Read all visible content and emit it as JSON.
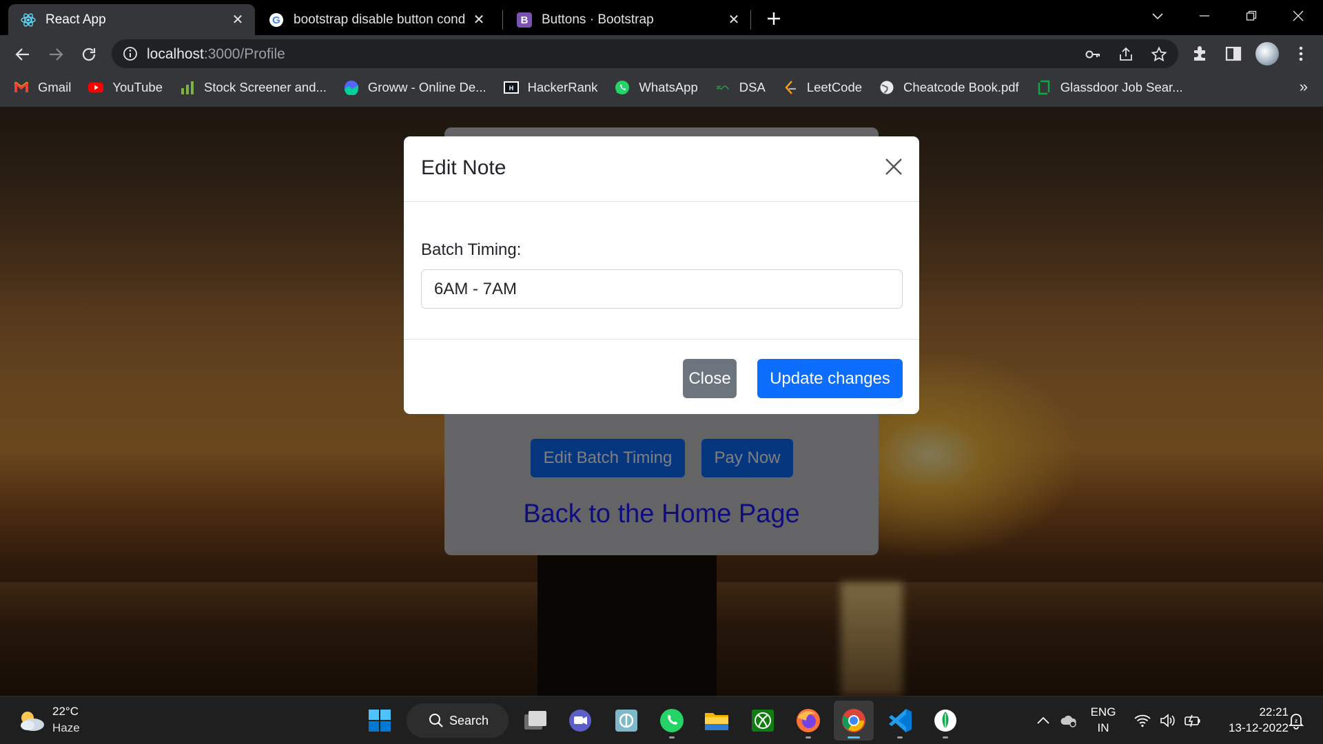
{
  "browser": {
    "tabs": [
      {
        "title": "React App",
        "icon": "react-icon",
        "active": true
      },
      {
        "title": "bootstrap disable button conditio",
        "icon": "google-icon",
        "active": false
      },
      {
        "title": "Buttons · Bootstrap",
        "icon": "bootstrap-icon",
        "active": false
      }
    ],
    "url_host": "localhost",
    "url_path": ":3000/Profile",
    "bookmarks": [
      {
        "label": "Gmail",
        "icon": "gmail-icon"
      },
      {
        "label": "YouTube",
        "icon": "youtube-icon"
      },
      {
        "label": "Stock Screener and...",
        "icon": "stock-chart-icon"
      },
      {
        "label": "Groww - Online De...",
        "icon": "groww-icon"
      },
      {
        "label": "HackerRank",
        "icon": "hackerrank-icon"
      },
      {
        "label": "WhatsApp",
        "icon": "whatsapp-icon"
      },
      {
        "label": "DSA",
        "icon": "dsa-icon"
      },
      {
        "label": "LeetCode",
        "icon": "leetcode-icon"
      },
      {
        "label": "Cheatcode Book.pdf",
        "icon": "globe-icon"
      },
      {
        "label": "Glassdoor Job Sear...",
        "icon": "glassdoor-icon"
      }
    ],
    "bookmarks_more": "»"
  },
  "page": {
    "edit_batch_label": "Edit Batch Timing",
    "pay_now_label": "Pay Now",
    "back_home_label": "Back to the Home Page",
    "accent_color": "#0d6efd"
  },
  "modal": {
    "title": "Edit Note",
    "field_label": "Batch Timing:",
    "field_value": "6AM - 7AM",
    "close_label": "Close",
    "update_label": "Update changes",
    "close_color": "#6c757d",
    "update_color": "#0d6efd"
  },
  "taskbar": {
    "weather_temp": "22°C",
    "weather_desc": "Haze",
    "search_label": "Search",
    "lang_top": "ENG",
    "lang_bottom": "IN",
    "time": "22:21",
    "date": "13-12-2022"
  }
}
